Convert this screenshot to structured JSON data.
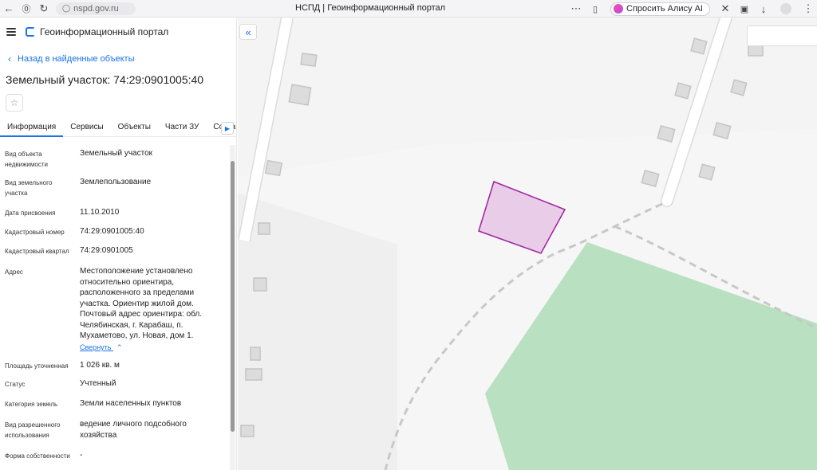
{
  "browser": {
    "url": "nspd.gov.ru",
    "tab_title": "НСПД | Геоинформационный портал",
    "alice_label": "Спросить Алису AI"
  },
  "portal": {
    "title": "Геоинформационный портал",
    "back_label": "Назад в найденные объекты",
    "object_title": "Земельный участок: 74:29:0901005:40"
  },
  "tabs": [
    "Информация",
    "Сервисы",
    "Объекты",
    "Части ЗУ",
    "Состав"
  ],
  "attributes": [
    {
      "label": "Вид объекта недвижимости",
      "value": "Земельный участок"
    },
    {
      "label": "Вид земельного участка",
      "value": "Землепользование"
    },
    {
      "label": "Дата присвоения",
      "value": "11.10.2010"
    },
    {
      "label": "Кадастровый номер",
      "value": "74:29:0901005:40"
    },
    {
      "label": "Кадастровый квартал",
      "value": "74:29:0901005"
    },
    {
      "label": "Адрес",
      "value": "Местоположение установлено относительно ориентира, расположенного за пределами участка. Ориентир жилой дом. Почтовый адрес ориентира: обл. Челябинская, г. Карабаш, п. Мухаметово, ул. Новая, дом 1."
    },
    {
      "label": "Площадь уточненная",
      "value": "1 026 кв. м"
    },
    {
      "label": "Статус",
      "value": "Учтенный"
    },
    {
      "label": "Категория земель",
      "value": "Земли населенных пунктов"
    },
    {
      "label": "Вид разрешенного использования",
      "value": "ведение личного подсобного хозяйства"
    },
    {
      "label": "Форма собственности",
      "value": "-"
    }
  ],
  "collapse_label": "Свернуть",
  "colors": {
    "accent": "#1a73e8",
    "parcel_fill": "#e8cce8",
    "parcel_stroke": "#a020a0",
    "green_area": "#b9e0c0"
  }
}
